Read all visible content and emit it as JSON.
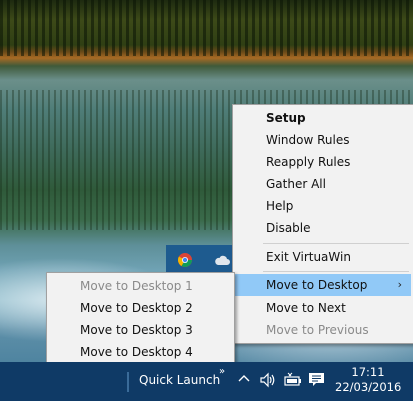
{
  "menu": {
    "items": [
      {
        "label": "Setup"
      },
      {
        "label": "Window Rules"
      },
      {
        "label": "Reapply Rules"
      },
      {
        "label": "Gather All"
      },
      {
        "label": "Help"
      },
      {
        "label": "Disable"
      },
      {
        "label": "Exit VirtuaWin"
      },
      {
        "label": "Move to Desktop"
      },
      {
        "label": "Move to Next"
      },
      {
        "label": "Move to Previous"
      }
    ],
    "highlighted": "Move to Desktop",
    "submenu_arrow": "›"
  },
  "submenu": {
    "items": [
      {
        "label": "Move to Desktop 1",
        "disabled": true
      },
      {
        "label": "Move to Desktop 2"
      },
      {
        "label": "Move to Desktop 3"
      },
      {
        "label": "Move to Desktop 4"
      }
    ]
  },
  "taskbar": {
    "quick_launch_label": "Quick Launch",
    "chevron": "»",
    "time": "17:11",
    "date": "22/03/2016",
    "color": "#0f3a66"
  },
  "tray_icons": [
    "chevron-up-icon",
    "volume-icon",
    "battery-icon",
    "notification-icon",
    "chrome-icon",
    "cloud-icon"
  ]
}
